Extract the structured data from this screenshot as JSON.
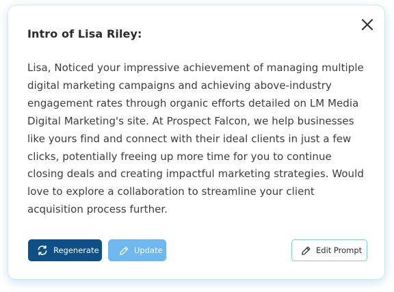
{
  "dialog": {
    "title": "Intro of Lisa Riley:",
    "body": "Lisa, Noticed your impressive achievement of managing multiple digital marketing campaigns and achieving above-industry engagement rates through organic efforts detailed on LM Media Digital Marketing's site. At Prospect Falcon, we help businesses like yours find and connect with their ideal clients in just a few clicks, potentially freeing up more time for you to continue closing deals and creating impactful marketing strategies. Would love to explore a collaboration to streamline your client acquisition process further."
  },
  "actions": {
    "regenerate_label": "Regenerate",
    "update_label": "Update",
    "edit_prompt_label": "Edit Prompt"
  },
  "icons": {
    "close": "close-icon",
    "regenerate": "refresh-icon",
    "update": "pencil-icon",
    "edit_prompt": "pencil-icon"
  },
  "colors": {
    "regenerate_bg": "#0d4f86",
    "update_bg": "#6fb7ef",
    "edit_prompt_border": "#7fc9e3",
    "card_border": "#cfe9f3"
  }
}
